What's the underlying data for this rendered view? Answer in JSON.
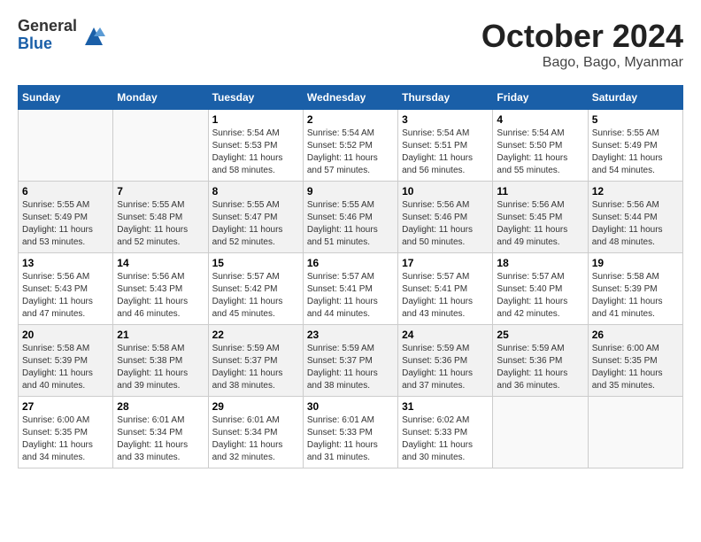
{
  "header": {
    "logo": {
      "general": "General",
      "blue": "Blue"
    },
    "title": "October 2024",
    "location": "Bago, Bago, Myanmar"
  },
  "calendar": {
    "days_of_week": [
      "Sunday",
      "Monday",
      "Tuesday",
      "Wednesday",
      "Thursday",
      "Friday",
      "Saturday"
    ],
    "weeks": [
      [
        {
          "day": "",
          "info": ""
        },
        {
          "day": "",
          "info": ""
        },
        {
          "day": "1",
          "info": "Sunrise: 5:54 AM\nSunset: 5:53 PM\nDaylight: 11 hours\nand 58 minutes."
        },
        {
          "day": "2",
          "info": "Sunrise: 5:54 AM\nSunset: 5:52 PM\nDaylight: 11 hours\nand 57 minutes."
        },
        {
          "day": "3",
          "info": "Sunrise: 5:54 AM\nSunset: 5:51 PM\nDaylight: 11 hours\nand 56 minutes."
        },
        {
          "day": "4",
          "info": "Sunrise: 5:54 AM\nSunset: 5:50 PM\nDaylight: 11 hours\nand 55 minutes."
        },
        {
          "day": "5",
          "info": "Sunrise: 5:55 AM\nSunset: 5:49 PM\nDaylight: 11 hours\nand 54 minutes."
        }
      ],
      [
        {
          "day": "6",
          "info": "Sunrise: 5:55 AM\nSunset: 5:49 PM\nDaylight: 11 hours\nand 53 minutes."
        },
        {
          "day": "7",
          "info": "Sunrise: 5:55 AM\nSunset: 5:48 PM\nDaylight: 11 hours\nand 52 minutes."
        },
        {
          "day": "8",
          "info": "Sunrise: 5:55 AM\nSunset: 5:47 PM\nDaylight: 11 hours\nand 52 minutes."
        },
        {
          "day": "9",
          "info": "Sunrise: 5:55 AM\nSunset: 5:46 PM\nDaylight: 11 hours\nand 51 minutes."
        },
        {
          "day": "10",
          "info": "Sunrise: 5:56 AM\nSunset: 5:46 PM\nDaylight: 11 hours\nand 50 minutes."
        },
        {
          "day": "11",
          "info": "Sunrise: 5:56 AM\nSunset: 5:45 PM\nDaylight: 11 hours\nand 49 minutes."
        },
        {
          "day": "12",
          "info": "Sunrise: 5:56 AM\nSunset: 5:44 PM\nDaylight: 11 hours\nand 48 minutes."
        }
      ],
      [
        {
          "day": "13",
          "info": "Sunrise: 5:56 AM\nSunset: 5:43 PM\nDaylight: 11 hours\nand 47 minutes."
        },
        {
          "day": "14",
          "info": "Sunrise: 5:56 AM\nSunset: 5:43 PM\nDaylight: 11 hours\nand 46 minutes."
        },
        {
          "day": "15",
          "info": "Sunrise: 5:57 AM\nSunset: 5:42 PM\nDaylight: 11 hours\nand 45 minutes."
        },
        {
          "day": "16",
          "info": "Sunrise: 5:57 AM\nSunset: 5:41 PM\nDaylight: 11 hours\nand 44 minutes."
        },
        {
          "day": "17",
          "info": "Sunrise: 5:57 AM\nSunset: 5:41 PM\nDaylight: 11 hours\nand 43 minutes."
        },
        {
          "day": "18",
          "info": "Sunrise: 5:57 AM\nSunset: 5:40 PM\nDaylight: 11 hours\nand 42 minutes."
        },
        {
          "day": "19",
          "info": "Sunrise: 5:58 AM\nSunset: 5:39 PM\nDaylight: 11 hours\nand 41 minutes."
        }
      ],
      [
        {
          "day": "20",
          "info": "Sunrise: 5:58 AM\nSunset: 5:39 PM\nDaylight: 11 hours\nand 40 minutes."
        },
        {
          "day": "21",
          "info": "Sunrise: 5:58 AM\nSunset: 5:38 PM\nDaylight: 11 hours\nand 39 minutes."
        },
        {
          "day": "22",
          "info": "Sunrise: 5:59 AM\nSunset: 5:37 PM\nDaylight: 11 hours\nand 38 minutes."
        },
        {
          "day": "23",
          "info": "Sunrise: 5:59 AM\nSunset: 5:37 PM\nDaylight: 11 hours\nand 38 minutes."
        },
        {
          "day": "24",
          "info": "Sunrise: 5:59 AM\nSunset: 5:36 PM\nDaylight: 11 hours\nand 37 minutes."
        },
        {
          "day": "25",
          "info": "Sunrise: 5:59 AM\nSunset: 5:36 PM\nDaylight: 11 hours\nand 36 minutes."
        },
        {
          "day": "26",
          "info": "Sunrise: 6:00 AM\nSunset: 5:35 PM\nDaylight: 11 hours\nand 35 minutes."
        }
      ],
      [
        {
          "day": "27",
          "info": "Sunrise: 6:00 AM\nSunset: 5:35 PM\nDaylight: 11 hours\nand 34 minutes."
        },
        {
          "day": "28",
          "info": "Sunrise: 6:01 AM\nSunset: 5:34 PM\nDaylight: 11 hours\nand 33 minutes."
        },
        {
          "day": "29",
          "info": "Sunrise: 6:01 AM\nSunset: 5:34 PM\nDaylight: 11 hours\nand 32 minutes."
        },
        {
          "day": "30",
          "info": "Sunrise: 6:01 AM\nSunset: 5:33 PM\nDaylight: 11 hours\nand 31 minutes."
        },
        {
          "day": "31",
          "info": "Sunrise: 6:02 AM\nSunset: 5:33 PM\nDaylight: 11 hours\nand 30 minutes."
        },
        {
          "day": "",
          "info": ""
        },
        {
          "day": "",
          "info": ""
        }
      ]
    ]
  }
}
